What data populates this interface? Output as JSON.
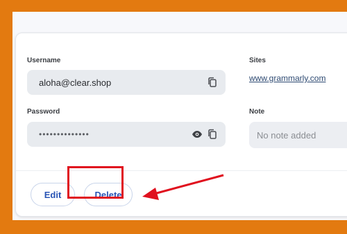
{
  "username": {
    "label": "Username",
    "value": "aloha@clear.shop"
  },
  "password": {
    "label": "Password",
    "value": "••••••••••••••"
  },
  "sites": {
    "label": "Sites",
    "link": "www.grammarly.com"
  },
  "note": {
    "label": "Note",
    "value": "No note added"
  },
  "actions": {
    "edit": "Edit",
    "delete": "Delete"
  },
  "icons": {
    "copy": "copy-icon",
    "eye": "eye-icon"
  },
  "colors": {
    "frame": "#e37a10",
    "highlight": "#e0101e",
    "arrow": "#e0101e",
    "accent": "#2a55b5"
  }
}
